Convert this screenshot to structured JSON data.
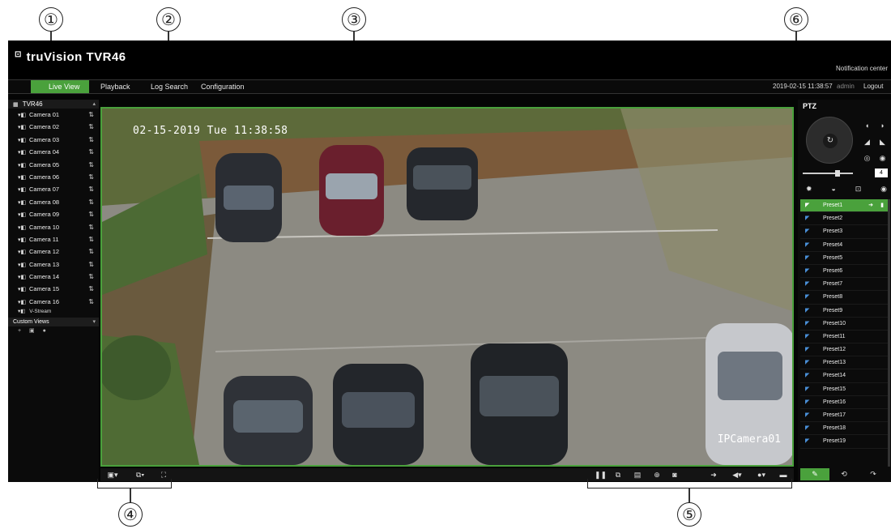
{
  "callouts": [
    "①",
    "②",
    "③",
    "④",
    "⑤",
    "⑥"
  ],
  "app": {
    "logo_mark": "⊡",
    "logo": "truVision TVR46",
    "notification_center": "Notification center"
  },
  "menu": {
    "items": [
      "Live View",
      "Playback",
      "Log Search",
      "Configuration"
    ],
    "active": "Live View",
    "datetime": "2019-02-15 11:38:57",
    "user": "admin",
    "logout": "Logout"
  },
  "left_panel": {
    "device": "TVR46",
    "cameras": [
      "Camera 01",
      "Camera 02",
      "Camera 03",
      "Camera 04",
      "Camera 05",
      "Camera 06",
      "Camera 07",
      "Camera 08",
      "Camera 09",
      "Camera 10",
      "Camera 11",
      "Camera 12",
      "Camera 13",
      "Camera 14",
      "Camera 15",
      "Camera 16"
    ],
    "vstream": "V-Stream",
    "custom_views": "Custom Views"
  },
  "video": {
    "osd_time": "02-15-2019 Tue 11:38:58",
    "osd_camera": "IPCamera01"
  },
  "ptz": {
    "title": "PTZ",
    "speed": "4",
    "presets": [
      "Preset1",
      "Preset2",
      "Preset3",
      "Preset4",
      "Preset5",
      "Preset6",
      "Preset7",
      "Preset8",
      "Preset9",
      "Preset10",
      "Preset11",
      "Preset12",
      "Preset13",
      "Preset14",
      "Preset15",
      "Preset16",
      "Preset17",
      "Preset18",
      "Preset19"
    ],
    "selected_preset": "Preset1"
  },
  "icons": {
    "ptz_dial_center": "↻",
    "zoom": [
      "zoom-in-icon",
      "zoom-out-icon",
      "focus-near-icon",
      "focus-far-icon",
      "iris-open-icon",
      "iris-close-icon"
    ],
    "toolbar_left": [
      "layout-icon",
      "layout-split-icon",
      "fullscreen-icon"
    ],
    "toolbar_right": [
      "pause-icon",
      "instant-playback-icon",
      "record-icon",
      "digital-zoom-icon",
      "snapshot-icon",
      "audio-icon",
      "volume-icon",
      "microphone-icon",
      "stop-icon"
    ]
  },
  "colors": {
    "accent": "#4aa13c",
    "background": "#050505",
    "preset_icon": "#4a90d9"
  }
}
